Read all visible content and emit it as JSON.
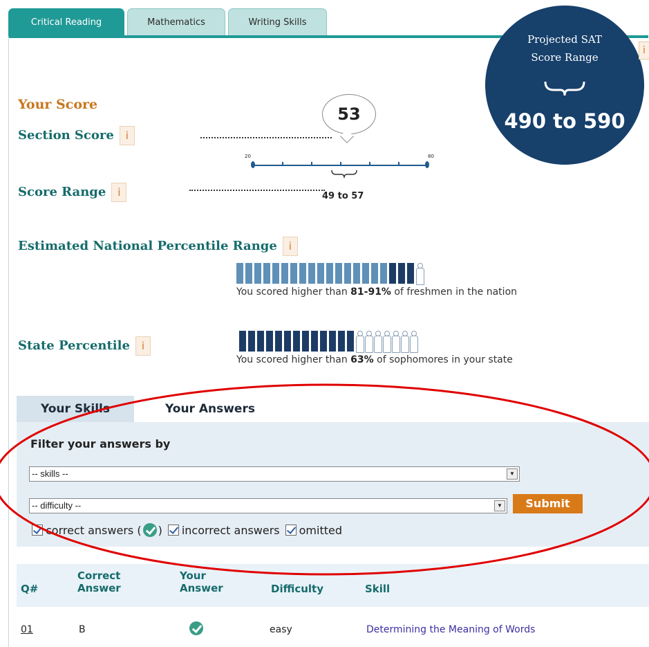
{
  "tabs": [
    {
      "label": "Critical Reading",
      "active": true
    },
    {
      "label": "Mathematics",
      "active": false
    },
    {
      "label": "Writing Skills",
      "active": false
    }
  ],
  "projected": {
    "line1": "Projected SAT",
    "line2": "Score Range",
    "range": "490 to 590",
    "info": "i"
  },
  "score": {
    "heading": "Your Score",
    "section_label": "Section Score",
    "section_value": "53",
    "range_label": "Score Range",
    "range_value": "49 to 57",
    "scale_min": "20",
    "scale_max": "80",
    "info": "i"
  },
  "national": {
    "label": "Estimated National Percentile Range",
    "text_prefix": "You scored higher than ",
    "text_value": "81-91%",
    "text_suffix": " of freshmen in the nation"
  },
  "state": {
    "label": "State Percentile",
    "text_prefix": "You scored higher than ",
    "text_value": "63%",
    "text_suffix": " of sophomores in your state"
  },
  "sub_tabs": [
    {
      "label": "Your Skills",
      "active": false
    },
    {
      "label": "Your Answers",
      "active": true
    }
  ],
  "filter": {
    "title": "Filter your answers by",
    "skills_value": "-- skills --",
    "difficulty_value": "-- difficulty --",
    "submit_label": "Submit",
    "correct_label_a": "correct answers (",
    "correct_label_b": ")",
    "incorrect_label": "incorrect answers",
    "omitted_label": "omitted"
  },
  "table": {
    "headers": {
      "q": "Q#",
      "correct_1": "Correct",
      "correct_2": "Answer",
      "your_1": "Your",
      "your_2": "Answer",
      "difficulty": "Difficulty",
      "skill": "Skill"
    },
    "rows": [
      {
        "q": "01",
        "correct": "B",
        "difficulty": "easy",
        "skill": "Determining the Meaning of Words"
      }
    ]
  },
  "colors": {
    "teal": "#1f9a96",
    "navy": "#17406b",
    "orange": "#d97a18",
    "annotation": "#e00000"
  }
}
